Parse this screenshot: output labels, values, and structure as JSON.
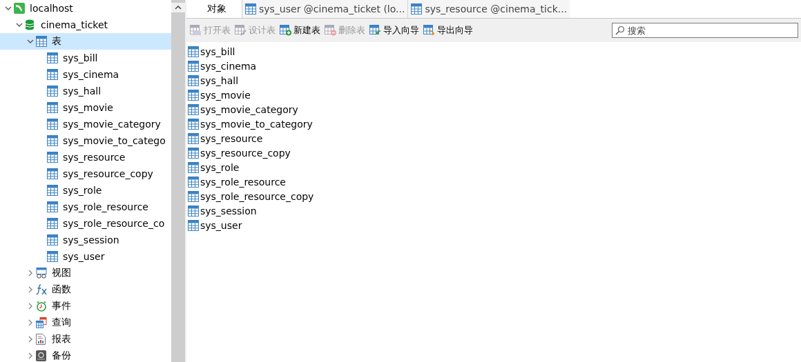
{
  "tree": [
    {
      "label": "localhost",
      "kind": "server",
      "expanded": true,
      "selected": false,
      "children": [
        {
          "label": "cinema_ticket",
          "kind": "database",
          "expanded": true,
          "selected": false,
          "children": [
            {
              "label": "表",
              "kind": "table-group",
              "expanded": true,
              "selected": true,
              "children": [
                {
                  "label": "sys_bill",
                  "kind": "table",
                  "selected": false
                },
                {
                  "label": "sys_cinema",
                  "kind": "table",
                  "selected": false
                },
                {
                  "label": "sys_hall",
                  "kind": "table",
                  "selected": false
                },
                {
                  "label": "sys_movie",
                  "kind": "table",
                  "selected": false
                },
                {
                  "label": "sys_movie_category",
                  "kind": "table",
                  "selected": false
                },
                {
                  "label": "sys_movie_to_catego",
                  "kind": "table",
                  "selected": false
                },
                {
                  "label": "sys_resource",
                  "kind": "table",
                  "selected": false
                },
                {
                  "label": "sys_resource_copy",
                  "kind": "table",
                  "selected": false
                },
                {
                  "label": "sys_role",
                  "kind": "table",
                  "selected": false
                },
                {
                  "label": "sys_role_resource",
                  "kind": "table",
                  "selected": false
                },
                {
                  "label": "sys_role_resource_co",
                  "kind": "table",
                  "selected": false
                },
                {
                  "label": "sys_session",
                  "kind": "table",
                  "selected": false
                },
                {
                  "label": "sys_user",
                  "kind": "table",
                  "selected": false
                }
              ]
            },
            {
              "label": "视图",
              "kind": "view",
              "expanded": false,
              "selected": false
            },
            {
              "label": "函数",
              "kind": "function",
              "expanded": false,
              "selected": false
            },
            {
              "label": "事件",
              "kind": "event",
              "expanded": false,
              "selected": false
            },
            {
              "label": "查询",
              "kind": "query",
              "expanded": false,
              "selected": false
            },
            {
              "label": "报表",
              "kind": "report",
              "expanded": false,
              "selected": false
            },
            {
              "label": "备份",
              "kind": "backup",
              "expanded": false,
              "selected": false
            }
          ]
        }
      ]
    }
  ],
  "tabs": [
    {
      "label": "对象",
      "kind": "objects",
      "selected": true
    },
    {
      "label": "sys_user @cinema_ticket (lo...",
      "kind": "table",
      "selected": false
    },
    {
      "label": "sys_resource @cinema_tick...",
      "kind": "table",
      "selected": false
    }
  ],
  "toolbar": [
    {
      "label": "打开表",
      "kind": "open",
      "disabled": true
    },
    {
      "label": "设计表",
      "kind": "design",
      "disabled": true
    },
    {
      "label": "新建表",
      "kind": "new",
      "disabled": false
    },
    {
      "label": "删除表",
      "kind": "delete",
      "disabled": true
    },
    {
      "label": "导入向导",
      "kind": "import",
      "disabled": false
    },
    {
      "label": "导出向导",
      "kind": "export",
      "disabled": false
    }
  ],
  "search": {
    "placeholder": "搜索"
  },
  "objects": [
    "sys_bill",
    "sys_cinema",
    "sys_hall",
    "sys_movie",
    "sys_movie_category",
    "sys_movie_to_category",
    "sys_resource",
    "sys_resource_copy",
    "sys_role",
    "sys_role_resource",
    "sys_role_resource_copy",
    "sys_session",
    "sys_user"
  ]
}
